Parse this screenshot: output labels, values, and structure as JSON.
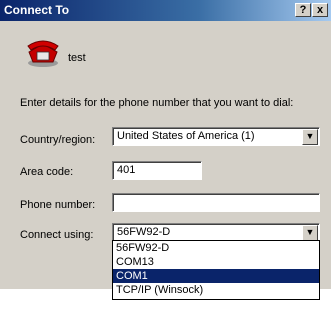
{
  "window": {
    "title": "Connect To",
    "help_label": "?",
    "close_label": "x"
  },
  "connection": {
    "name": "test",
    "icon": "phone-icon"
  },
  "instructions": "Enter details for the phone number that you want to dial:",
  "form": {
    "country_label": "Country/region:",
    "country_value": "United States of America (1)",
    "area_label": "Area code:",
    "area_value": "401",
    "phone_label": "Phone number:",
    "phone_value": "",
    "connect_label": "Connect using:",
    "connect_value": "56FW92-D"
  },
  "dropdown": {
    "options": [
      "56FW92-D",
      "COM13",
      "COM1",
      "TCP/IP (Winsock)"
    ],
    "selected_index": 2
  },
  "colors": {
    "titlebar": "#0a246a",
    "selection": "#0a246a",
    "face": "#d4d0c8"
  }
}
